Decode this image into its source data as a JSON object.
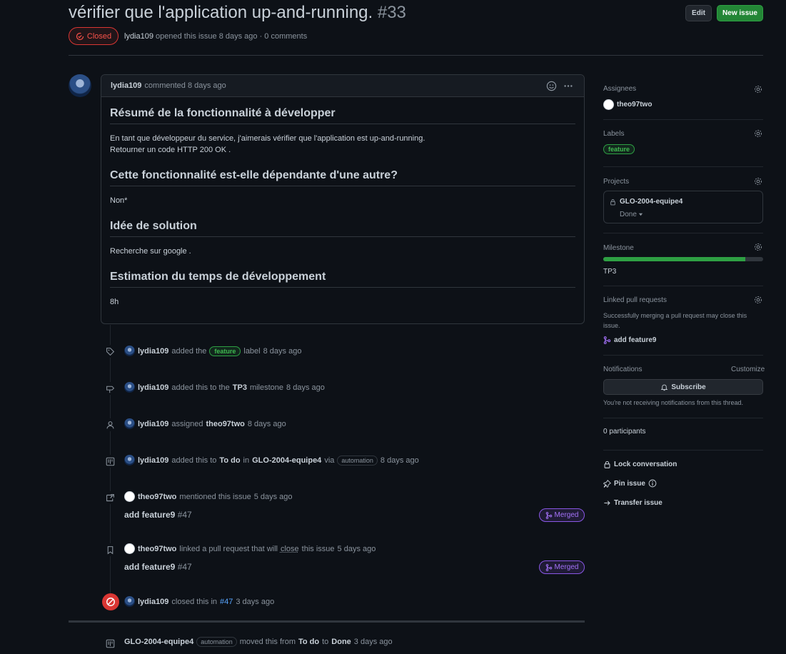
{
  "issue": {
    "title": "vérifier que l'application up-and-running.",
    "number": "#33",
    "state": "Closed",
    "author": "lydia109",
    "meta_text": "opened this issue 8 days ago · 0 comments"
  },
  "header": {
    "edit_label": "Edit",
    "new_issue_label": "New issue"
  },
  "comment": {
    "author": "lydia109",
    "action": "commented 8 days ago",
    "sections": [
      {
        "heading": "Résumé de la fonctionnalité à développer",
        "lines": [
          "En tant que développeur du service, j'aimerais vérifier que l'application est up-and-running.",
          "Retourner un code HTTP 200 OK ."
        ]
      },
      {
        "heading": "Cette fonctionnalité est-elle dépendante d'une autre?",
        "lines": [
          "Non*"
        ]
      },
      {
        "heading": "Idée de solution",
        "lines": [
          "Recherche sur google ."
        ]
      },
      {
        "heading": "Estimation du temps de développement",
        "lines": [
          "8h"
        ]
      }
    ]
  },
  "timeline": {
    "e1": {
      "actor": "lydia109",
      "t1": "added the",
      "label": "feature",
      "t2": "label",
      "time": "8 days ago"
    },
    "e2": {
      "actor": "lydia109",
      "t1": "added this to the",
      "milestone": "TP3",
      "t2": "milestone",
      "time": "8 days ago"
    },
    "e3": {
      "actor": "lydia109",
      "t1": "assigned",
      "assignee": "theo97two",
      "time": "8 days ago"
    },
    "e4": {
      "actor": "lydia109",
      "t1": "added this to",
      "column": "To do",
      "t2": "in",
      "project": "GLO-2004-equipe4",
      "t3": "via",
      "via": "automation",
      "time": "8 days ago"
    },
    "e5": {
      "actor": "theo97two",
      "t1": "mentioned this issue",
      "time": "5 days ago",
      "pr_title": "add feature9",
      "pr_number": "#47",
      "pr_state": "Merged"
    },
    "e6": {
      "actor": "theo97two",
      "t1": "linked a pull request that will",
      "close_word": "close",
      "t2": "this issue",
      "time": "5 days ago",
      "pr_title": "add feature9",
      "pr_number": "#47",
      "pr_state": "Merged"
    },
    "e7": {
      "actor": "lydia109",
      "t1": "closed this in",
      "ref": "#47",
      "time": "3 days ago"
    },
    "e8": {
      "actor": "GLO-2004-equipe4",
      "via": "automation",
      "t1": "moved this from",
      "from": "To do",
      "t2": "to",
      "to": "Done",
      "time": "3 days ago"
    }
  },
  "sidebar": {
    "assignees_label": "Assignees",
    "assignee": "theo97two",
    "labels_label": "Labels",
    "label": "feature",
    "projects_label": "Projects",
    "project_name": "GLO-2004-equipe4",
    "project_status": "Done",
    "milestone_label": "Milestone",
    "milestone_progress": 0.89,
    "milestone_name": "TP3",
    "linked_pr_label": "Linked pull requests",
    "linked_pr_help": "Successfully merging a pull request may close this issue.",
    "linked_pr": "add feature9",
    "notifications_label": "Notifications",
    "customize": "Customize",
    "subscribe": "Subscribe",
    "notif_help": "You're not receiving notifications from this thread.",
    "participants": "0 participants",
    "lock": "Lock conversation",
    "pin": "Pin issue",
    "transfer": "Transfer issue"
  },
  "colors": {
    "bg": "#0d1117",
    "closed": "#da3633",
    "green": "#238636",
    "merged": "#8957e5"
  }
}
